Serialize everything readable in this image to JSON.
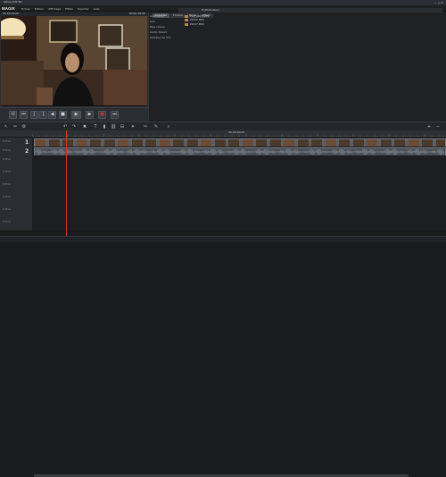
{
  "app": {
    "logo": "MAGIX",
    "title": "Movie Edit Pro"
  },
  "menu": [
    "Fichier",
    "Edition",
    "Affichage",
    "Effets",
    "Exporter",
    "Aide"
  ],
  "preview": {
    "timecode_left": "00:00:00:00",
    "timecode_right": "00:00:00:00"
  },
  "transport": {
    "buttons": [
      {
        "name": "loop-icon",
        "glyph": "⟲"
      },
      {
        "name": "start-icon",
        "glyph": "⏮"
      },
      {
        "name": "mark-in-icon",
        "glyph": "["
      },
      {
        "name": "mark-out-icon",
        "glyph": "]"
      },
      {
        "name": "prev-icon",
        "glyph": "◀"
      },
      {
        "name": "stop-icon",
        "glyph": "■"
      },
      {
        "name": "play-icon",
        "glyph": "▶"
      },
      {
        "name": "next-icon",
        "glyph": "▶"
      },
      {
        "name": "record-icon",
        "glyph": "●"
      },
      {
        "name": "end-icon",
        "glyph": "⏭"
      }
    ]
  },
  "pool": {
    "tabs": [
      "Importer",
      "Fondus",
      "Titres",
      "Effets"
    ],
    "path": "E:\\Ordinateur",
    "sidebar": [
      "Ordinateur",
      "test",
      "Mes vidéos",
      "Outils MAGIX",
      "Modèles de film"
    ],
    "files": [
      "FILE_ARCHIVES",
      "P1010.MOV",
      "P1017.MOV"
    ]
  },
  "timeline": {
    "tracks": [
      {
        "num": "1",
        "type": "video"
      },
      {
        "num": "2",
        "type": "audio"
      },
      {
        "num": "3",
        "type": "empty"
      },
      {
        "num": "4",
        "type": "empty"
      },
      {
        "num": "5",
        "type": "empty"
      },
      {
        "num": "6",
        "type": "empty"
      },
      {
        "num": "7",
        "type": "empty"
      },
      {
        "num": "8",
        "type": "empty"
      }
    ],
    "ruler_label": "00:00:00:00"
  },
  "colors": {
    "accent_record": "#d8342c",
    "clip": "#5a5f66"
  }
}
